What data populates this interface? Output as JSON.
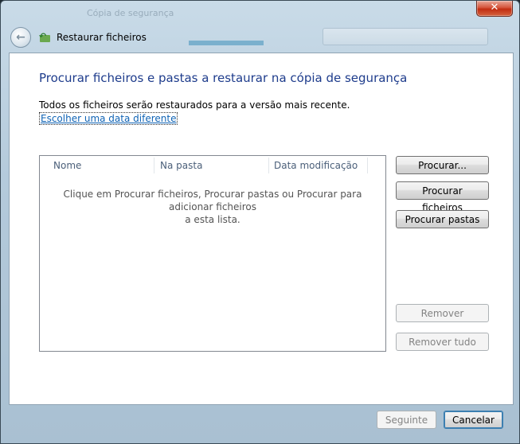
{
  "window": {
    "background_title": "Cópia de segurança",
    "nav_title": "Restaurar ficheiros",
    "icons": {
      "back": "back-arrow-icon",
      "app": "restore-files-icon",
      "close": "close-icon"
    }
  },
  "main": {
    "heading": "Procurar ficheiros e pastas a restaurar na cópia de segurança",
    "info": "Todos os ficheiros serão restaurados para a versão mais recente.",
    "link": "Escolher uma data diferente"
  },
  "list": {
    "columns": [
      "Nome",
      "Na pasta",
      "Data modificação"
    ],
    "empty_line1": "Clique em Procurar ficheiros, Procurar pastas ou Procurar para adicionar ficheiros",
    "empty_line2": "a esta lista."
  },
  "buttons": {
    "procurar": "Procurar...",
    "procurar_ficheiros": "Procurar ficheiros",
    "procurar_pastas": "Procurar pastas",
    "remover": "Remover",
    "remover_tudo": "Remover tudo"
  },
  "footer": {
    "next": "Seguinte",
    "cancel": "Cancelar"
  },
  "colors": {
    "heading": "#1e3c8c",
    "link": "#0f63b5",
    "close": "#c22d12"
  }
}
